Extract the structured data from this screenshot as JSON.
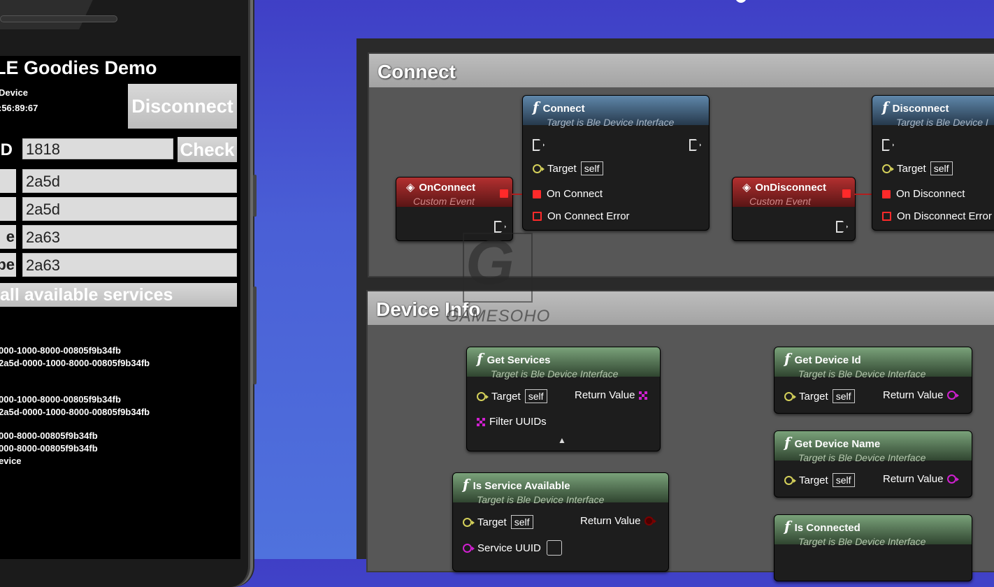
{
  "phone": {
    "app_title": "LE Goodies Demo",
    "device_label": "Device",
    "device_address": ":56:89:67",
    "disconnect_label": "Disconnect",
    "uuid_label": "ID",
    "uuid_value": "1818",
    "check_label": "Check",
    "rows": [
      {
        "left": "",
        "value": "2a5d"
      },
      {
        "left": "",
        "value": "2a5d"
      },
      {
        "left": "e",
        "value": "2a63"
      },
      {
        "left": "be",
        "value": "2a63"
      }
    ],
    "all_services_label": "all available services",
    "log_lines": [
      "000-1000-8000-00805f9b34fb",
      "2a5d-0000-1000-8000-00805f9b34fb",
      "000-1000-8000-00805f9b34fb",
      "2a5d-0000-1000-8000-00805f9b34fb",
      "000-8000-00805f9b34fb",
      "000-8000-00805f9b34fb",
      "evice"
    ]
  },
  "blueprint": {
    "connect_comment": "Connect",
    "device_info_comment": "Device Info",
    "target_subtitle": "Target is Ble Device Interface",
    "target_subtitle_cut": "Target is Ble Device I",
    "custom_event": "Custom Event",
    "target_label": "Target",
    "self_label": "self",
    "return_value_label": "Return Value",
    "nodes": {
      "connect": {
        "title": "Connect",
        "pin1": "On Connect",
        "pin2": "On Connect Error"
      },
      "disconnect": {
        "title": "Disconnect",
        "pin1": "On Disconnect",
        "pin2": "On Disconnect Error"
      },
      "on_connect": {
        "title": "OnConnect"
      },
      "on_disconnect": {
        "title": "OnDisconnect"
      },
      "get_services": {
        "title": "Get Services",
        "extra_pin": "Filter UUIDs",
        "expand_icon": "triangle-up"
      },
      "get_device_id": {
        "title": "Get Device Id"
      },
      "get_device_name": {
        "title": "Get Device Name"
      },
      "is_service_available": {
        "title": "Is Service Available",
        "extra_pin": "Service UUID"
      },
      "is_connected": {
        "title": "Is Connected"
      }
    }
  },
  "watermark": {
    "text": "GAMESOHO",
    "letter": "G"
  },
  "colors": {
    "exec_pin": "#ff2a2a",
    "object_pin": "#d4d05a",
    "array_pin": "#d020d0",
    "bool_pin": "#7a0000",
    "function_header_blue": "#5f87aa",
    "function_header_green": "#7aa27a",
    "event_header_red": "#b33030"
  }
}
